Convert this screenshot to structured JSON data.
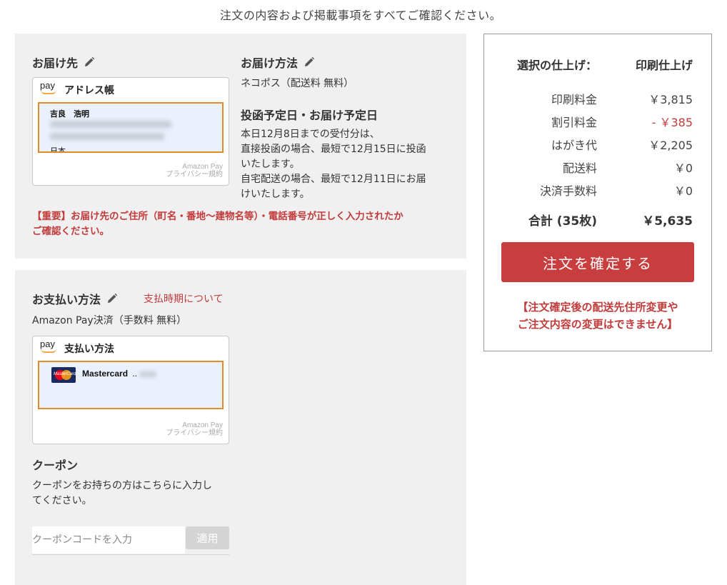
{
  "top_note": "注文の内容および掲載事項をすべてご確認ください。",
  "delivery": {
    "address_heading": "お届け先",
    "amazon_pay_logo": "pay",
    "address_book_title": "アドレス帳",
    "recipient_name": "吉良　浩明",
    "country": "日本",
    "amazon_pay_footer_1": "Amazon Pay",
    "amazon_pay_footer_2": "プライバシー規約",
    "method_heading": "お届け方法",
    "method_value": "ネコポス（配送料 無料）",
    "schedule_heading": "投函予定日・お届け予定日",
    "schedule_lines": [
      "本日12月8日までの受付分は、",
      "直接投函の場合、最短で12月15日に投函",
      "いたします。",
      "自宅配送の場合、最短で12月11日にお届",
      "けいたします。"
    ],
    "warning_line_1": "【重要】お届け先のご住所（町名・番地〜建物名等）・電話番号が正しく入力されたか",
    "warning_line_2": "ご確認ください。"
  },
  "payment": {
    "heading": "お支払い方法",
    "timing_link": "支払時期について",
    "method_value": "Amazon Pay決済（手数料 無料）",
    "amazon_pay_logo": "pay",
    "box_title": "支払い方法",
    "card_brand": "Mastercard",
    "card_logo_text": "MasterCard",
    "card_suffix": "..",
    "amazon_pay_footer_1": "Amazon Pay",
    "amazon_pay_footer_2": "プライバシー規約",
    "coupon_heading": "クーポン",
    "coupon_desc_1": "クーポンをお持ちの方はこちらに入力し",
    "coupon_desc_2": "てください。",
    "coupon_placeholder": "クーポンコードを入力",
    "coupon_apply": "適用"
  },
  "summary": {
    "finish_label": "選択の仕上げ：",
    "finish_value": "印刷仕上げ",
    "rows": [
      {
        "label": "印刷料金",
        "value": "￥3,815"
      },
      {
        "label": "割引料金",
        "value": "- ￥385"
      },
      {
        "label": "はがき代",
        "value": "￥2,205"
      },
      {
        "label": "配送料",
        "value": "￥0"
      },
      {
        "label": "決済手数料",
        "value": "￥0"
      }
    ],
    "total_label": "合計 (35枚)",
    "total_value": "￥5,635",
    "confirm_button": "注文を確定する",
    "note_line_1": "【注文確定後の配送先住所変更や",
    "note_line_2": "ご注文内容の変更はできません】"
  },
  "colors": {
    "accent_red": "#c83d3d",
    "amazon_orange": "#e08c2a",
    "panel_bg": "#f0f0f0"
  },
  "icons": {
    "edit": "pencil-icon",
    "amazon_pay": "amazon-pay-logo",
    "card": "mastercard-logo"
  }
}
